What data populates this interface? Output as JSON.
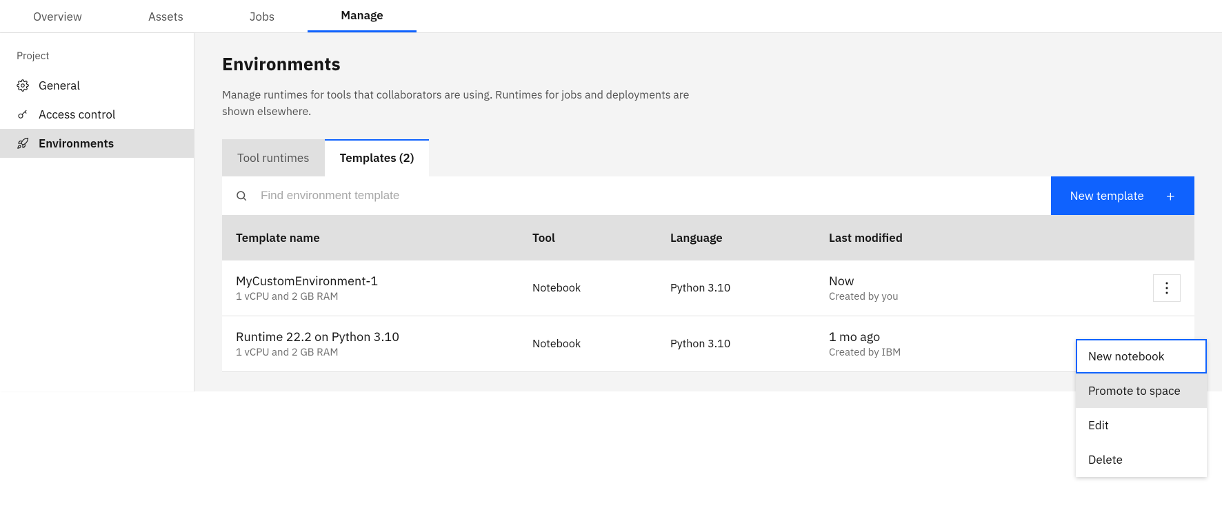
{
  "topnav": {
    "tabs": [
      "Overview",
      "Assets",
      "Jobs",
      "Manage"
    ],
    "active_index": 3
  },
  "sidebar": {
    "heading": "Project",
    "items": [
      {
        "label": "General",
        "icon": "gear"
      },
      {
        "label": "Access control",
        "icon": "key"
      },
      {
        "label": "Environments",
        "icon": "rocket"
      }
    ],
    "active_index": 2
  },
  "page": {
    "title": "Environments",
    "subtitle": "Manage runtimes for tools that collaborators are using. Runtimes for jobs and deployments are shown elsewhere."
  },
  "envtabs": {
    "tabs": [
      "Tool runtimes",
      "Templates (2)"
    ],
    "active_index": 1
  },
  "search": {
    "placeholder": "Find environment template",
    "value": ""
  },
  "new_button": "New template",
  "table": {
    "columns": [
      "Template name",
      "Tool",
      "Language",
      "Last modified"
    ],
    "rows": [
      {
        "name": "MyCustomEnvironment-1",
        "spec": "1 vCPU and 2 GB RAM",
        "tool": "Notebook",
        "language": "Python 3.10",
        "modified": "Now",
        "created_by": "Created by you"
      },
      {
        "name": "Runtime 22.2 on Python 3.10",
        "spec": "1 vCPU and 2 GB RAM",
        "tool": "Notebook",
        "language": "Python 3.10",
        "modified": "1 mo ago",
        "created_by": "Created by IBM"
      }
    ]
  },
  "context_menu": {
    "items": [
      "New notebook",
      "Promote to space",
      "Edit",
      "Delete"
    ],
    "selected_index": 0,
    "hover_index": 1
  }
}
